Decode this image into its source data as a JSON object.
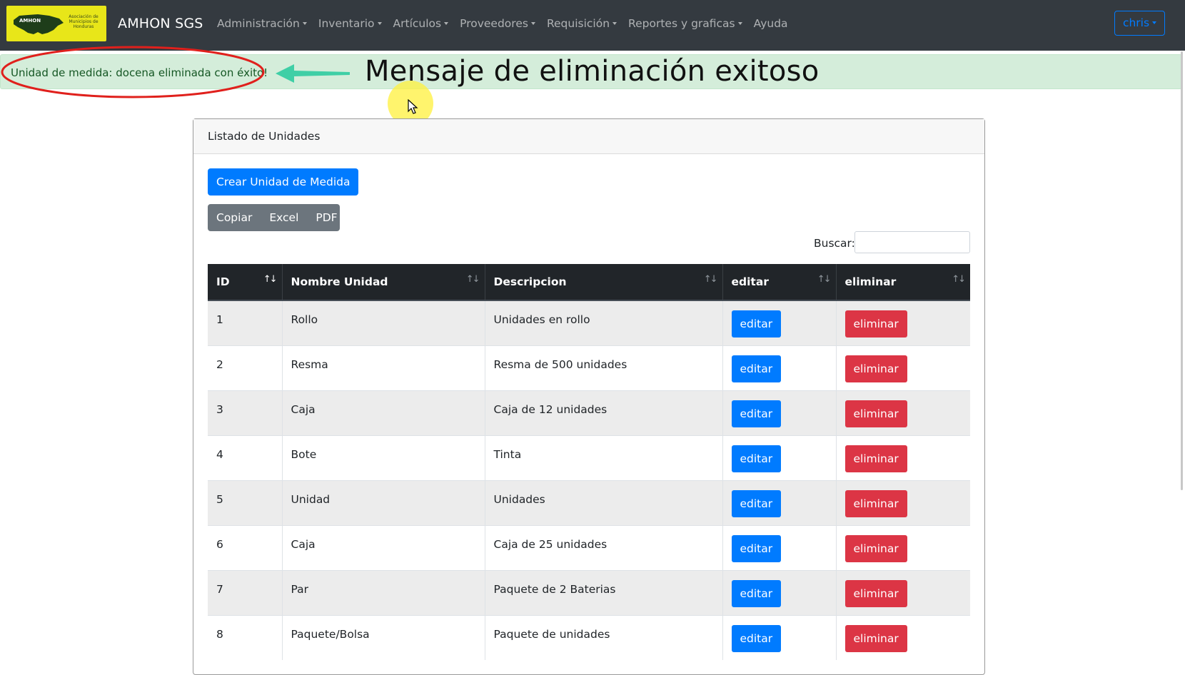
{
  "navbar": {
    "logo_text": "AMHON",
    "logo_subtext": "Asociación de Municipios de Honduras",
    "brand": "AMHON SGS",
    "menu": [
      "Administración",
      "Inventario",
      "Artículos",
      "Proveedores",
      "Requisición",
      "Reportes y graficas",
      "Ayuda"
    ],
    "user": "chris"
  },
  "alert": {
    "message": "Unidad de medida: docena eliminada con éxito!"
  },
  "annotation": {
    "label": "Mensaje de eliminación exitoso"
  },
  "card": {
    "title": "Listado de Unidades",
    "create_button": "Crear Unidad de Medida",
    "export": {
      "copy": "Copiar",
      "excel": "Excel",
      "pdf": "PDF"
    },
    "search_label": "Buscar:",
    "search_value": ""
  },
  "table": {
    "headers": [
      "ID",
      "Nombre Unidad",
      "Descripcion",
      "editar",
      "eliminar"
    ],
    "edit_label": "editar",
    "delete_label": "eliminar",
    "rows": [
      {
        "id": "1",
        "name": "Rollo",
        "desc": "Unidades en rollo"
      },
      {
        "id": "2",
        "name": "Resma",
        "desc": "Resma de 500 unidades"
      },
      {
        "id": "3",
        "name": "Caja",
        "desc": "Caja de 12 unidades"
      },
      {
        "id": "4",
        "name": "Bote",
        "desc": "Tinta"
      },
      {
        "id": "5",
        "name": "Unidad",
        "desc": "Unidades"
      },
      {
        "id": "6",
        "name": "Caja",
        "desc": "Caja de 25 unidades"
      },
      {
        "id": "7",
        "name": "Par",
        "desc": "Paquete de 2 Baterias"
      },
      {
        "id": "8",
        "name": "Paquete/Bolsa",
        "desc": "Paquete de unidades"
      }
    ]
  },
  "colors": {
    "navbar": "#343a40",
    "primary": "#007bff",
    "danger": "#dc3545",
    "secondary": "#6c757d",
    "success_bg": "#d4edda",
    "annotation_red": "#e0201c",
    "annotation_arrow": "#3fcfa6"
  }
}
